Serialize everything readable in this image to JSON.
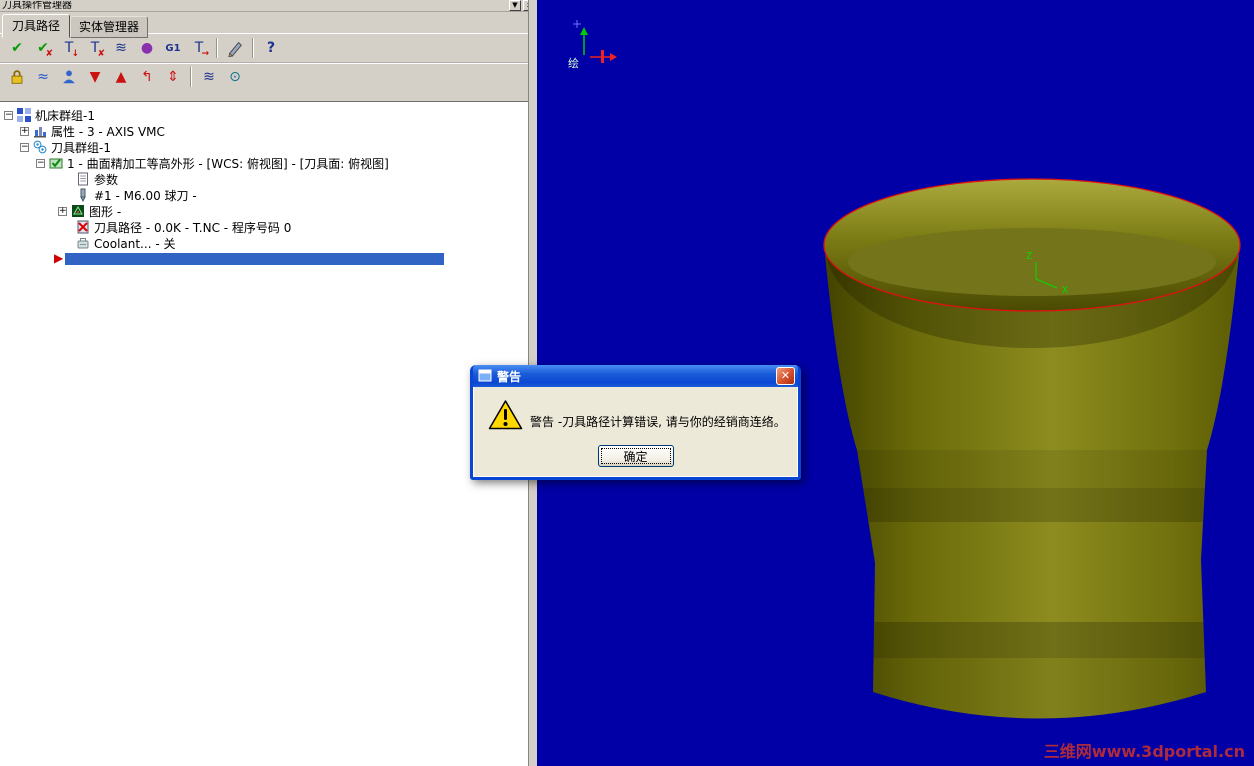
{
  "window": {
    "title": "刀具操作管理器",
    "minimize_glyph": "▼",
    "close_glyph": "x"
  },
  "tabs": [
    {
      "label": "刀具路径"
    },
    {
      "label": "实体管理器"
    }
  ],
  "toolbar": {
    "row1": [
      {
        "name": "select-all-operations",
        "glyph": "✔",
        "sub": ""
      },
      {
        "name": "clear-selection",
        "glyph": "✔",
        "sub": "✘"
      },
      {
        "name": "regenerate-selected",
        "glyph": "T",
        "sub": "↓"
      },
      {
        "name": "regenerate-all",
        "glyph": "T",
        "sub": "✘"
      },
      {
        "name": "toolpath-display",
        "glyph": "≋",
        "sub": ""
      },
      {
        "name": "verify",
        "glyph": "●",
        "sub": ""
      },
      {
        "name": "backplot",
        "glyph": "G1",
        "sub": ""
      },
      {
        "name": "post-selected",
        "glyph": "T",
        "sub": "→"
      },
      {
        "name": "edit-tool",
        "glyph": "",
        "sub": ""
      },
      {
        "name": "help",
        "glyph": "?",
        "sub": ""
      }
    ],
    "row2": [
      {
        "name": "lock",
        "glyph": "",
        "sub": ""
      },
      {
        "name": "toolpath-visibility",
        "glyph": "≈",
        "sub": ""
      },
      {
        "name": "display-options",
        "glyph": "",
        "sub": ""
      },
      {
        "name": "move-insert-down",
        "glyph": "▼",
        "sub": ""
      },
      {
        "name": "move-insert-up",
        "glyph": "▲",
        "sub": ""
      },
      {
        "name": "move-insert-arrow",
        "glyph": "↰",
        "sub": ""
      },
      {
        "name": "scroll-insert",
        "glyph": "⇕",
        "sub": ""
      },
      {
        "name": "toolpath-trim",
        "glyph": "≋",
        "sub": ""
      },
      {
        "name": "feed-optimize",
        "glyph": "⊙",
        "sub": ""
      }
    ]
  },
  "tree": {
    "expander_open": "−",
    "expander_closed": "+",
    "insert_arrow": "▶",
    "items": [
      {
        "label": "机床群组-1"
      },
      {
        "label": "属性 - 3 - AXIS VMC"
      },
      {
        "label": "刀具群组-1"
      },
      {
        "label": "1 - 曲面精加工等高外形 - [WCS: 俯视图] - [刀具面: 俯视图]"
      },
      {
        "label": "参数"
      },
      {
        "label": "#1 - M6.00 球刀 -"
      },
      {
        "label": "图形 -"
      },
      {
        "label": "刀具路径 - 0.0K - T.NC - 程序号码 0"
      },
      {
        "label": "Coolant... - 关"
      }
    ]
  },
  "dialog": {
    "title": "警告",
    "close_glyph": "✕",
    "message": "警告 -刀具路径计算错误, 请与你的经销商连络。",
    "ok_label": "确定"
  },
  "viewport": {
    "gizmo_label": "绘",
    "axis_z_label": "Z",
    "axis_x_label": "X",
    "watermark": "三维网www.3dportal.cn"
  },
  "colors": {
    "viewport_bg": "#0000A6",
    "model_olive": "#7D7D15",
    "selection_blue": "#3163C5",
    "dialog_title_blue": "#0A46D4",
    "rim_outline_red": "#E01010",
    "watermark_red": "#C03030"
  }
}
